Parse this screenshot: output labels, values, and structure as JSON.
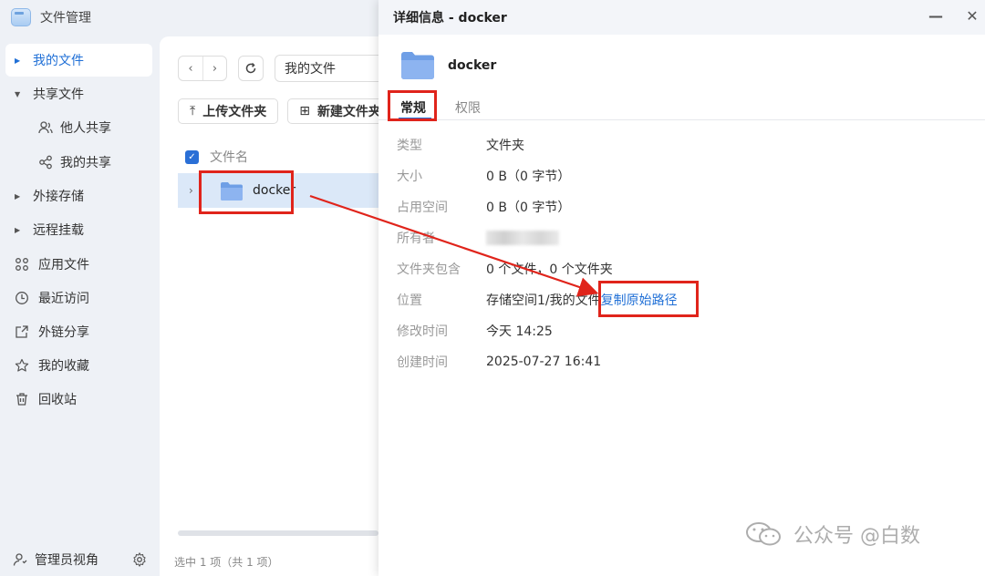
{
  "app": {
    "title": "文件管理"
  },
  "sidebar": {
    "items": [
      {
        "label": "我的文件",
        "icon": "caret-right",
        "active": true
      },
      {
        "label": "共享文件",
        "icon": "caret-down"
      },
      {
        "label": "他人共享",
        "icon": "users-icon",
        "sub": true
      },
      {
        "label": "我的共享",
        "icon": "share-icon",
        "sub": true
      },
      {
        "label": "外接存储",
        "icon": "caret-right"
      },
      {
        "label": "远程挂载",
        "icon": "caret-right"
      },
      {
        "label": "应用文件",
        "icon": "apps-icon"
      },
      {
        "label": "最近访问",
        "icon": "clock-icon"
      },
      {
        "label": "外链分享",
        "icon": "link-share-icon"
      },
      {
        "label": "我的收藏",
        "icon": "star-icon"
      },
      {
        "label": "回收站",
        "icon": "trash-icon"
      }
    ],
    "bottom": {
      "label": "管理员视角",
      "icon": "admin-user-icon",
      "settings_icon": "gear-icon"
    }
  },
  "main": {
    "path": "我的文件",
    "toolbar": {
      "upload_label": "上传文件夹",
      "new_label": "新建文件夹"
    },
    "list_header": "文件名",
    "rows": [
      {
        "name": "docker"
      }
    ],
    "status": "选中 1 项（共 1 项）"
  },
  "dialog": {
    "title": "详细信息 - docker",
    "name": "docker",
    "tabs": [
      {
        "label": "常规",
        "active": true
      },
      {
        "label": "权限"
      }
    ],
    "props": [
      {
        "label": "类型",
        "value": "文件夹"
      },
      {
        "label": "大小",
        "value": "0 B（0 字节）"
      },
      {
        "label": "占用空间",
        "value": "0 B（0 字节）"
      },
      {
        "label": "所有者",
        "value": ""
      },
      {
        "label": "文件夹包含",
        "value": "0 个文件，0 个文件夹"
      },
      {
        "label": "位置",
        "value": "存储空间1/我的文件",
        "link": "复制原始路径"
      },
      {
        "label": "修改时间",
        "value": "今天 14:25"
      },
      {
        "label": "创建时间",
        "value": "2025-07-27 16:41"
      }
    ]
  },
  "watermark": {
    "text": "公众号 @白数"
  },
  "colors": {
    "accent": "#1f6fd6",
    "annotation": "#e0241b",
    "folder": "#7aa8ea"
  }
}
